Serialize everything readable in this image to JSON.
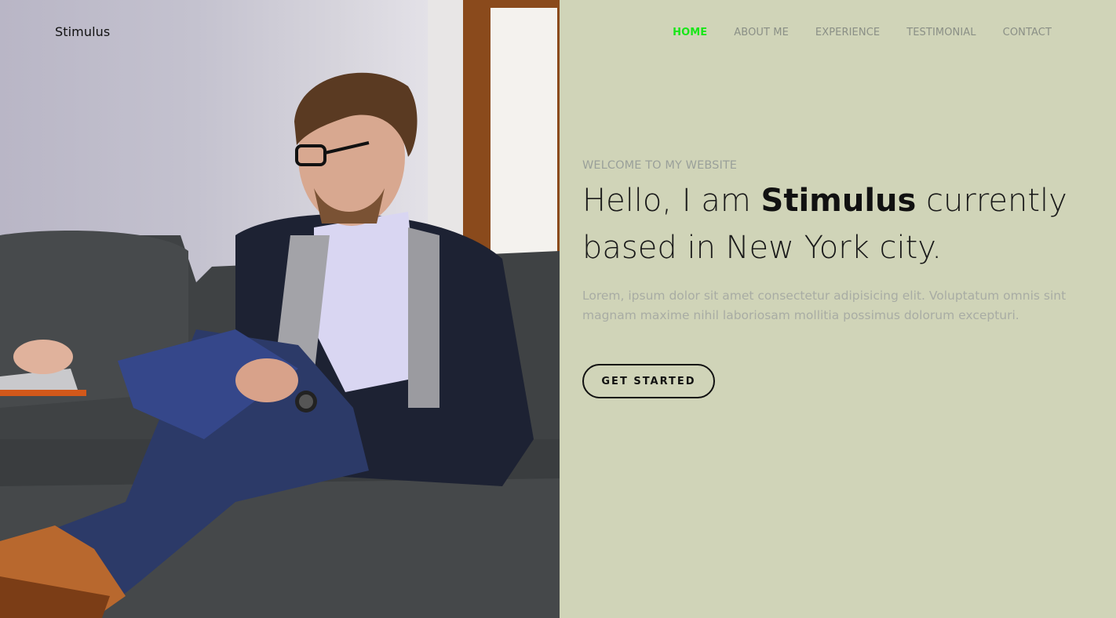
{
  "brand": {
    "name": "Stimulus"
  },
  "nav": {
    "items": [
      {
        "label": "HOME",
        "active": true
      },
      {
        "label": "ABOUT ME"
      },
      {
        "label": "EXPERIENCE"
      },
      {
        "label": "TESTIMONIAL"
      },
      {
        "label": "CONTACT"
      }
    ]
  },
  "hero": {
    "kicker": "WELCOME TO MY WEBSITE",
    "headline_pre": "Hello, I am ",
    "headline_name": "Stimulus",
    "headline_post": " currently based in New York city.",
    "lead": "Lorem, ipsum dolor sit amet consectetur adipisicing elit. Voluptatum omnis sint magnam maxime nihil laboriosam mollitia possimus dolorum excepturi.",
    "cta_label": "GET STARTED"
  },
  "photo": {
    "icon": "man-on-sofa-photo"
  },
  "colors": {
    "background": "#d0d4b8",
    "active_nav": "#19e619",
    "muted_text": "#a8aca4"
  }
}
